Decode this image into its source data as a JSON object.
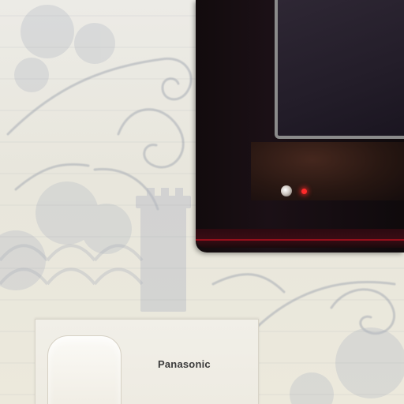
{
  "scene": {
    "device_panel": {
      "brand_label": "Panasonic"
    },
    "tv": {
      "power_led_color": "#ff2a2a"
    }
  }
}
